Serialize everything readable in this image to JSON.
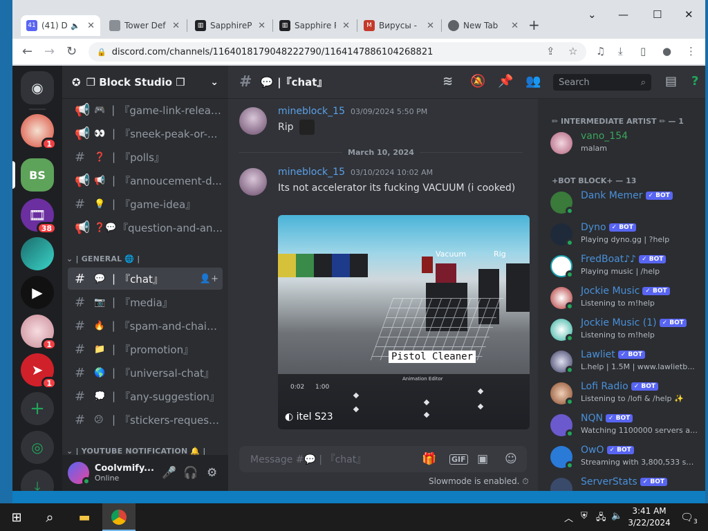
{
  "browser": {
    "tabs": [
      {
        "title": "(41) Di",
        "favicon": "discord-icon"
      },
      {
        "title": "Tower Defe",
        "favicon": "tower-defense-icon"
      },
      {
        "title": "SapphireP",
        "favicon": "sapphire-icon"
      },
      {
        "title": "Sapphire P",
        "favicon": "sapphire-icon"
      },
      {
        "title": "Вирусы - ",
        "favicon": "ms-icon"
      },
      {
        "title": "New Tab",
        "favicon": "chrome-icon"
      }
    ],
    "url": "discord.com/channels/1164018179048222790/1164147886104268821"
  },
  "discord": {
    "server_name": "❒ Block Studio ❒",
    "channel_header": "|『chat』",
    "search_placeholder": "Search",
    "guild_badges": [
      "1",
      "38",
      "1",
      "1"
    ],
    "channels": [
      {
        "emoji": "🎮",
        "name": "『game-link-releas...",
        "type": "announce"
      },
      {
        "emoji": "👀",
        "name": "『sneek-peak-or-...",
        "type": "announce"
      },
      {
        "emoji": "❓",
        "name": "『polls』",
        "type": "text"
      },
      {
        "emoji": "📢",
        "name": "『annoucement-d...",
        "type": "announce"
      },
      {
        "emoji": "💡",
        "name": "『game-idea』",
        "type": "text"
      },
      {
        "emoji": "❓💬",
        "name": "『question-and-an...",
        "type": "announce"
      }
    ],
    "category_general": "| GENERAL 🌐 |",
    "general_channels": [
      {
        "emoji": "💬",
        "name": "『chat』"
      },
      {
        "emoji": "📷",
        "name": "『media』"
      },
      {
        "emoji": "🔥",
        "name": "『spam-and-chain』"
      },
      {
        "emoji": "📁",
        "name": "『promotion』"
      },
      {
        "emoji": "🌎",
        "name": "『universal-chat』"
      },
      {
        "emoji": "💭",
        "name": "『any-suggestion』"
      },
      {
        "emoji": "😕",
        "name": "『stickers-request..."
      }
    ],
    "category_youtube": "| YOUTUBE NOTIFICATION 🔔 |",
    "user": {
      "name": "Coolvmify...",
      "status": "Online"
    },
    "messages": [
      {
        "author": "mineblock_15",
        "timestamp": "03/09/2024 5:50 PM",
        "text": "Rip"
      },
      {
        "author": "mineblock_15",
        "timestamp": "03/10/2024 10:02 AM",
        "text": "Its not accelerator its fucking VACUUM (i cooked)"
      }
    ],
    "date_divider": "March 10, 2024",
    "video": {
      "caption": "Pistol Cleaner",
      "label_vacuum": "Vacuum",
      "label_rig": "Rig",
      "watermark": "itel S23",
      "time_current": "0:02",
      "time_total": "1:00",
      "editor_label": "Animation Editor"
    },
    "composer_placeholder": "Message #💬 | 『chat』",
    "slowmode_text": "Slowmode is enabled. ⏱",
    "members": {
      "group1": "✏ INTERMEDIATE ARTIST ✏ — 1",
      "group1_members": [
        {
          "name": "vano_154",
          "sub": "malam",
          "bot": false
        }
      ],
      "group2": "+BOT BLOCK+ — 13",
      "group2_members": [
        {
          "name": "Dank Memer",
          "sub": "",
          "bot": true
        },
        {
          "name": "Dyno",
          "sub": "Playing dyno.gg | ?help",
          "bot": true
        },
        {
          "name": "FredBoat♪♪",
          "sub": "Playing music | /help",
          "bot": true
        },
        {
          "name": "Jockie Music",
          "sub": "Listening to m!help",
          "bot": true
        },
        {
          "name": "Jockie Music (1)",
          "sub": "Listening to m!help",
          "bot": true
        },
        {
          "name": "Lawliet",
          "sub": "L.help | 1.5M | www.lawlietb...",
          "bot": true
        },
        {
          "name": "Lofi Radio",
          "sub": "Listening to /lofi & /help ✨",
          "bot": true
        },
        {
          "name": "NQN",
          "sub": "Watching 1100000 servers an...",
          "bot": true
        },
        {
          "name": "OwO",
          "sub": "Streaming with 3,800,533 ser...",
          "bot": true
        },
        {
          "name": "ServerStats",
          "sub": "",
          "bot": true
        }
      ],
      "bot_tag": "✓ BOT"
    }
  },
  "taskbar": {
    "time": "3:41 AM",
    "date": "3/22/2024",
    "notifications": "3"
  },
  "colors": {
    "discord_blurple": "#5865f2",
    "online_green": "#23a55a",
    "badge_red": "#f23f43"
  }
}
